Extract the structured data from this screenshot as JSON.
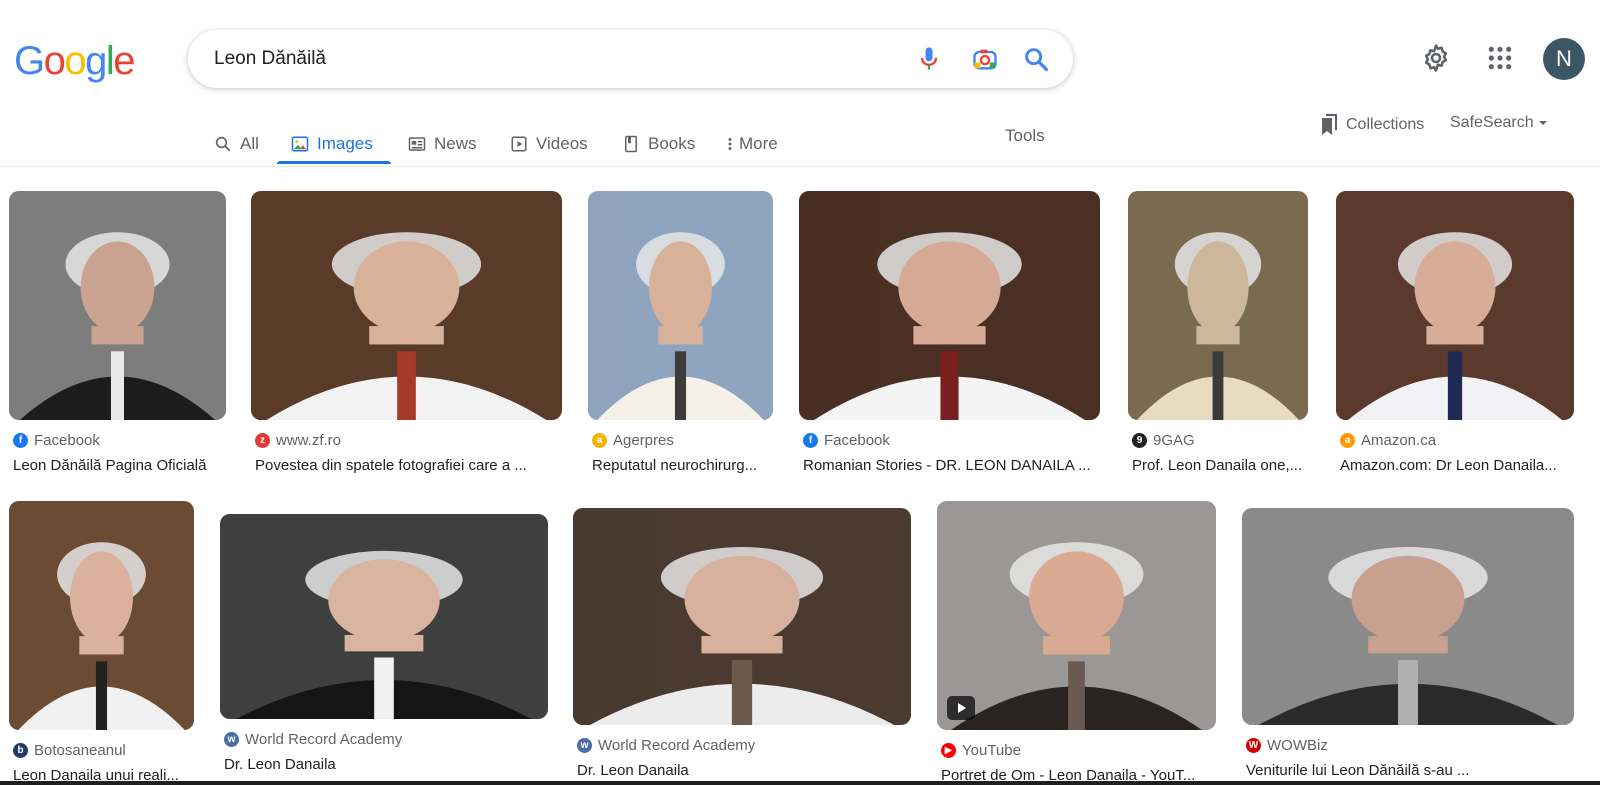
{
  "header": {
    "logo_letters": [
      "G",
      "o",
      "o",
      "g",
      "l",
      "e"
    ],
    "search_query": "Leon Dănăilă",
    "avatar_letter": "N"
  },
  "tabs": [
    {
      "label": "All",
      "icon": "search-icon"
    },
    {
      "label": "Images",
      "icon": "image-icon",
      "active": true
    },
    {
      "label": "News",
      "icon": "news-icon"
    },
    {
      "label": "Videos",
      "icon": "video-icon"
    },
    {
      "label": "Books",
      "icon": "book-icon"
    },
    {
      "label": "More",
      "icon": "more-vert-icon"
    }
  ],
  "toolbar": {
    "tools": "Tools",
    "collections": "Collections",
    "safesearch": "SafeSearch"
  },
  "colors": {
    "accent": "#1a73e8",
    "google_blue": "#4285f4",
    "google_red": "#ea4335",
    "google_yellow": "#fbbc05",
    "google_green": "#34a853"
  },
  "results": [
    {
      "source": "Facebook",
      "title": "Leon Dănăilă Pagina Oficială",
      "favicon": "facebook-icon"
    },
    {
      "source": "www.zf.ro",
      "title": "Povestea din spatele fotografiei care a ...",
      "favicon": "zf-icon"
    },
    {
      "source": "Agerpres",
      "title": "Reputatul neurochirurg...",
      "favicon": "agerpres-icon"
    },
    {
      "source": "Facebook",
      "title": "Romanian Stories - DR. LEON DANAILA ...",
      "favicon": "facebook-icon"
    },
    {
      "source": "9GAG",
      "title": "Prof. Leon Danaila one,...",
      "favicon": "9gag-icon"
    },
    {
      "source": "Amazon.ca",
      "title": "Amazon.com: Dr Leon Danaila...",
      "favicon": "amazon-icon"
    },
    {
      "source": "Botosaneanul",
      "title": "Leon Danaila unui reali...",
      "favicon": "botosaneanul-icon"
    },
    {
      "source": "World Record Academy",
      "title": "Dr. Leon Danaila",
      "favicon": "world-record-icon"
    },
    {
      "source": "World Record Academy",
      "title": "Dr. Leon Danaila",
      "favicon": "world-record-icon"
    },
    {
      "source": "YouTube",
      "title": "Portret de Om - Leon Danaila - YouT...",
      "favicon": "youtube-icon",
      "video": true
    },
    {
      "source": "WOWBiz",
      "title": "Veniturile lui Leon Dănăilă s-au ...",
      "favicon": "wowbiz-icon"
    }
  ]
}
